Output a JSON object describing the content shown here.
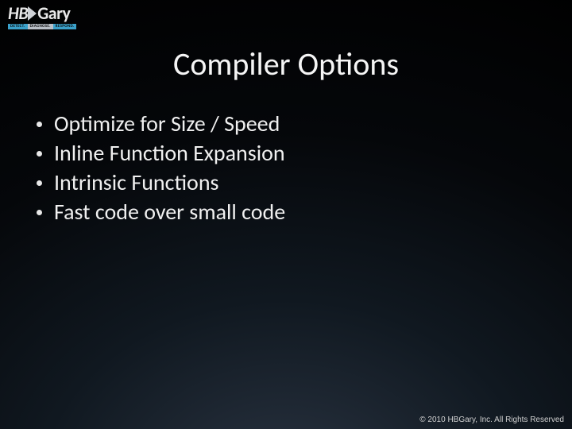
{
  "logo": {
    "hb": "HB",
    "gary": "Gary",
    "tagline": {
      "detect": "DETECT.",
      "diagnose": "DIAGNOSE.",
      "respond": "RESPOND."
    }
  },
  "title": "Compiler Options",
  "bullets": [
    "Optimize for Size / Speed",
    "Inline Function Expansion",
    "Intrinsic Functions",
    "Fast code over small code"
  ],
  "footer": "© 2010 HBGary, Inc. All Rights Reserved"
}
